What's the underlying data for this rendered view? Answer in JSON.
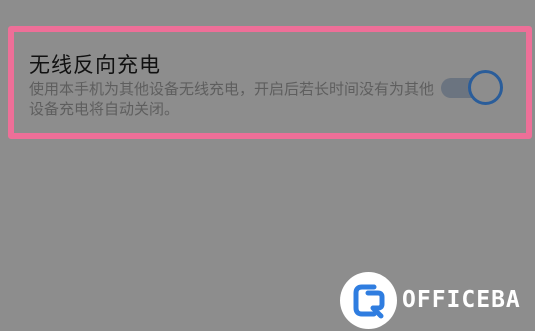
{
  "setting": {
    "title": "无线反向充电",
    "description": "使用本手机为其他设备无线充电，开启后若长时间没有为其他设备充电将自动关闭。",
    "enabled": true
  },
  "watermark": {
    "text": "OFFICEBA"
  },
  "colors": {
    "background": "#8d8d8d",
    "highlight": "#ee6f98",
    "toggle_accent": "#2a5d9a"
  }
}
